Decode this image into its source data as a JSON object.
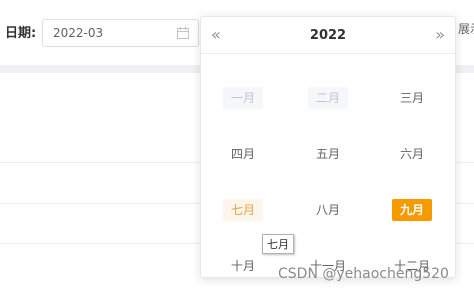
{
  "filter": {
    "label": "日期:",
    "value": "2022-03",
    "calendar_icon": "calendar-icon"
  },
  "top_right_text": "展示",
  "picker": {
    "year": "2022",
    "prev_label": "«",
    "next_label": "»",
    "months": [
      {
        "label": "一月",
        "state": "disabled"
      },
      {
        "label": "二月",
        "state": "disabled"
      },
      {
        "label": "三月",
        "state": "normal"
      },
      {
        "label": "四月",
        "state": "normal"
      },
      {
        "label": "五月",
        "state": "normal"
      },
      {
        "label": "六月",
        "state": "normal"
      },
      {
        "label": "七月",
        "state": "current"
      },
      {
        "label": "八月",
        "state": "normal"
      },
      {
        "label": "九月",
        "state": "selected"
      },
      {
        "label": "十月",
        "state": "normal"
      },
      {
        "label": "十一月",
        "state": "normal"
      },
      {
        "label": "十二月",
        "state": "normal"
      }
    ]
  },
  "tooltip": "七月",
  "watermark": "CSDN @yehaocheng520",
  "colors": {
    "selected_bg": "#f59a00",
    "current_text": "#e6a23c",
    "disabled_bg": "#f5f7fa"
  }
}
